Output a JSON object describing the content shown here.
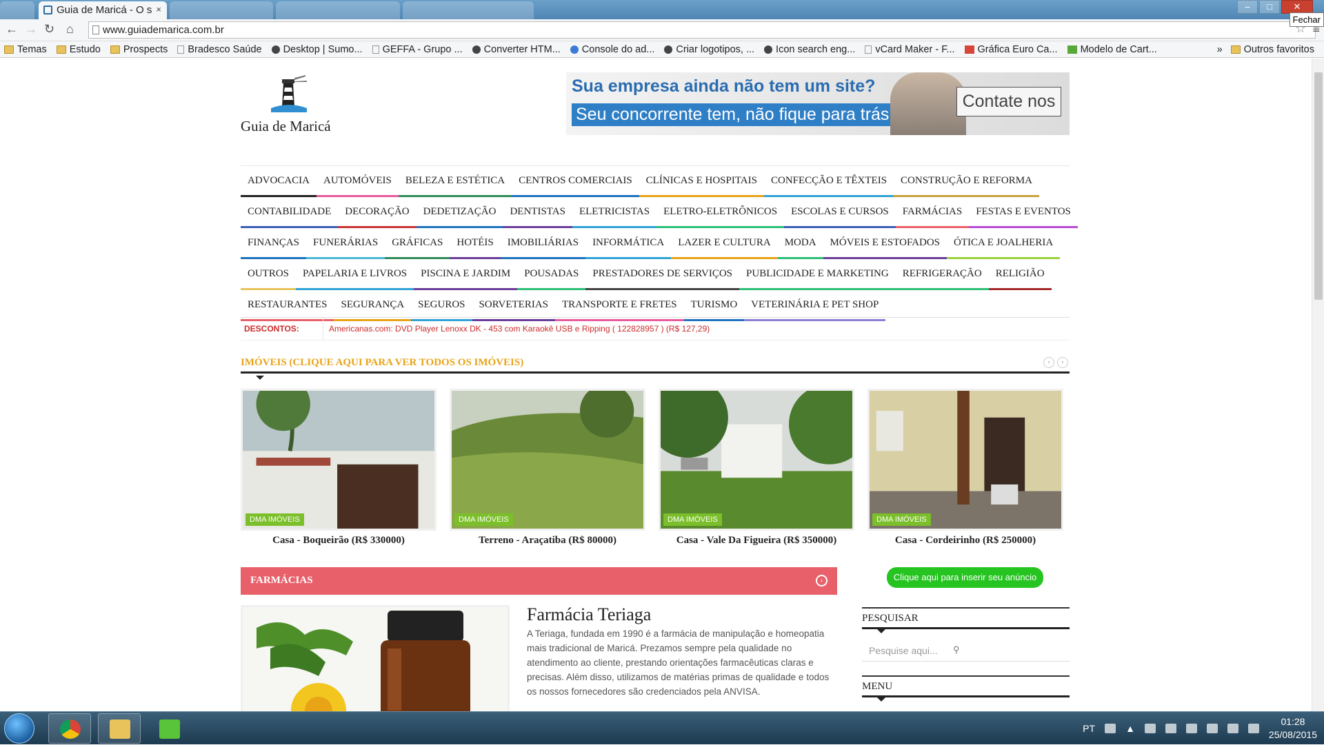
{
  "browser": {
    "active_tab_title": "Guia de Maricá - O s",
    "tab_close": "×",
    "tooltip": "Fechar",
    "url": "www.guiademarica.com.br",
    "bookmarks": [
      {
        "label": "Temas",
        "icon": "folder"
      },
      {
        "label": "Estudo",
        "icon": "folder"
      },
      {
        "label": "Prospects",
        "icon": "folder"
      },
      {
        "label": "Bradesco Saúde",
        "icon": "page"
      },
      {
        "label": "Desktop | Sumo...",
        "icon": "dot"
      },
      {
        "label": "GEFFA - Grupo ...",
        "icon": "page"
      },
      {
        "label": "Converter HTM...",
        "icon": "dot"
      },
      {
        "label": "Console do ad...",
        "icon": "blue"
      },
      {
        "label": "Criar logotipos, ...",
        "icon": "dot"
      },
      {
        "label": "Icon search eng...",
        "icon": "dot"
      },
      {
        "label": "vCard Maker - F...",
        "icon": "page"
      },
      {
        "label": "Gráfica Euro Ca...",
        "icon": "red"
      },
      {
        "label": "Modelo de Cart...",
        "icon": "grn"
      }
    ],
    "bookmarks_more": "»",
    "other_bookmarks": "Outros favoritos"
  },
  "site": {
    "logo_text": "Guia de Maricá",
    "banner": {
      "line1": "Sua empresa ainda não tem um site?",
      "line2": "Seu concorrente tem, não fique para trás.",
      "cta": "Contate nos"
    },
    "categories": [
      [
        {
          "label": "ADVOCACIA",
          "color": "#222222"
        },
        {
          "label": "AUTOMÓVEIS",
          "color": "#e85a9b"
        },
        {
          "label": "BELEZA E ESTÉTICA",
          "color": "#2e8b57"
        },
        {
          "label": "CENTROS COMERCIAIS",
          "color": "#1e73be"
        },
        {
          "label": "CLÍNICAS E HOSPITAIS",
          "color": "#e8a317"
        },
        {
          "label": "CONFECÇÃO E TÊXTEIS",
          "color": "#2ea3d6"
        },
        {
          "label": "CONSTRUÇÃO E REFORMA",
          "color": "#c8a23c"
        }
      ],
      [
        {
          "label": "CONTABILIDADE",
          "color": "#3a5fb8"
        },
        {
          "label": "DECORAÇÃO",
          "color": "#cc3333"
        },
        {
          "label": "DEDETIZAÇÃO",
          "color": "#1e73be"
        },
        {
          "label": "DENTISTAS",
          "color": "#6a3d9a"
        },
        {
          "label": "ELETRICISTAS",
          "color": "#2ea3d6"
        },
        {
          "label": "ELETRO-ELETRÔNICOS",
          "color": "#2bbf77"
        },
        {
          "label": "ESCOLAS E CURSOS",
          "color": "#3a5fb8"
        },
        {
          "label": "FARMÁCIAS",
          "color": "#e8606a"
        },
        {
          "label": "FESTAS E EVENTOS",
          "color": "#b84bd6"
        }
      ],
      [
        {
          "label": "FINANÇAS",
          "color": "#1e73be"
        },
        {
          "label": "FUNERÁRIAS",
          "color": "#4bb8d6"
        },
        {
          "label": "GRÁFICAS",
          "color": "#2e8b57"
        },
        {
          "label": "HOTÉIS",
          "color": "#6a3d9a"
        },
        {
          "label": "IMOBILIÁRIAS",
          "color": "#1e73be"
        },
        {
          "label": "INFORMÁTICA",
          "color": "#2ea3d6"
        },
        {
          "label": "LAZER E CULTURA",
          "color": "#e8a317"
        },
        {
          "label": "MODA",
          "color": "#2bbf77"
        },
        {
          "label": "MÓVEIS E ESTOFADOS",
          "color": "#6a3d9a"
        },
        {
          "label": "ÓTICA E JOALHERIA",
          "color": "#9bd13c"
        }
      ],
      [
        {
          "label": "OUTROS",
          "color": "#e8c35c"
        },
        {
          "label": "PAPELARIA E LIVROS",
          "color": "#2ea3d6"
        },
        {
          "label": "PISCINA E JARDIM",
          "color": "#6a3d9a"
        },
        {
          "label": "POUSADAS",
          "color": "#2bbf77"
        },
        {
          "label": "PRESTADORES DE SERVIÇOS",
          "color": "#444444"
        },
        {
          "label": "PUBLICIDADE E MARKETING",
          "color": "#2bbf77"
        },
        {
          "label": "REFRIGERAÇÃO",
          "color": "#2bbf77"
        },
        {
          "label": "RELIGIÃO",
          "color": "#a52a2a"
        }
      ],
      [
        {
          "label": "RESTAURANTES",
          "color": "#e8606a"
        },
        {
          "label": "SEGURANÇA",
          "color": "#e8a317"
        },
        {
          "label": "SEGUROS",
          "color": "#2ea3d6"
        },
        {
          "label": "SORVETERIAS",
          "color": "#6a3d9a"
        },
        {
          "label": "TRANSPORTE E FRETES",
          "color": "#e85a9b"
        },
        {
          "label": "TURISMO",
          "color": "#1e73be"
        },
        {
          "label": "VETERINÁRIA E PET SHOP",
          "color": "#8a7fd6"
        }
      ]
    ],
    "descontos_label": "DESCONTOS:",
    "descontos_text": "Americanas.com: DVD Player Lenoxx DK - 453 com Karaokê USB e Ripping ( 122828957 ) (R$ 127,29)",
    "imoveis_heading": "IMÓVEIS (CLIQUE AQUI PARA VER TODOS OS IMÓVEIS)",
    "listings": [
      {
        "badge": "DMA IMÓVEIS",
        "caption": "Casa - Boqueirão (R$ 330000)"
      },
      {
        "badge": "DMA IMÓVEIS",
        "caption": "Terreno - Araçatiba (R$ 80000)"
      },
      {
        "badge": "DMA IMÓVEIS",
        "caption": "Casa - Vale Da Figueira (R$ 350000)"
      },
      {
        "badge": "DMA IMÓVEIS",
        "caption": "Casa - Cordeirinho (R$ 250000)"
      }
    ],
    "farmacias_heading": "FARMÁCIAS",
    "featured": {
      "title": "Farmácia Teriaga",
      "description": "A Teriaga, fundada em 1990 é a farmácia de manipulação e homeopatia mais tradicional de Maricá. Prezamos sempre pela qualidade no atendimento ao cliente, prestando orientações farmacêuticas claras e precisas. Além disso, utilizamos de matérias primas de qualidade e todos os nossos fornecedores são credenciados pela ANVISA."
    },
    "sidebar": {
      "insert_ad_button": "Clique aqui para inserir seu anúncio",
      "search_heading": "PESQUISAR",
      "search_placeholder": "Pesquise aqui...",
      "menu_heading": "MENU"
    }
  },
  "taskbar": {
    "language": "PT",
    "time": "01:28",
    "date": "25/08/2015"
  }
}
